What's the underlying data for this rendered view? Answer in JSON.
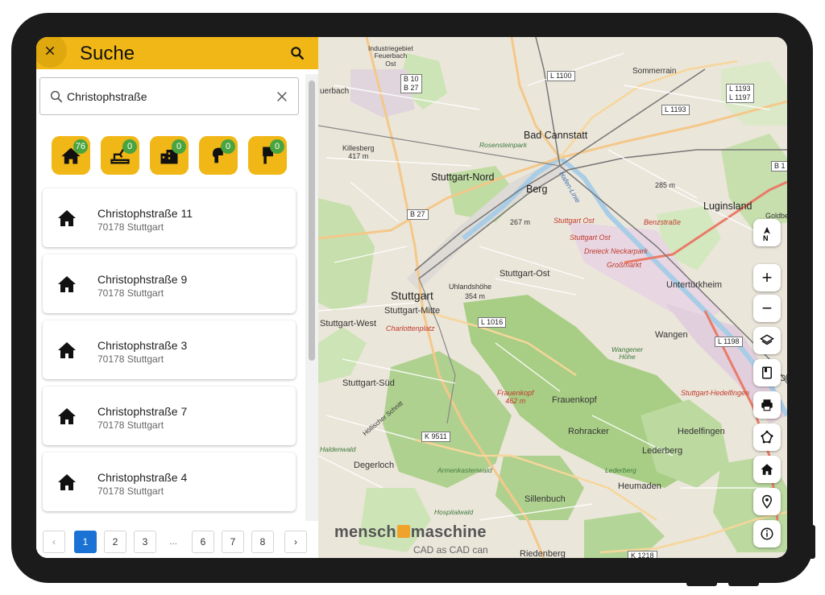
{
  "header": {
    "title": "Suche"
  },
  "search": {
    "value": "Christophstraße",
    "placeholder": ""
  },
  "categories": [
    {
      "icon": "house-icon",
      "count": "76"
    },
    {
      "icon": "excavator-icon",
      "count": "0"
    },
    {
      "icon": "building-icon",
      "count": "0"
    },
    {
      "icon": "hand-flag-icon",
      "count": "0"
    },
    {
      "icon": "flag-icon",
      "count": "0"
    }
  ],
  "results": [
    {
      "title": "Christophstraße 11",
      "subtitle": "70178 Stuttgart"
    },
    {
      "title": "Christophstraße 9",
      "subtitle": "70178 Stuttgart"
    },
    {
      "title": "Christophstraße 3",
      "subtitle": "70178 Stuttgart"
    },
    {
      "title": "Christophstraße 7",
      "subtitle": "70178 Stuttgart"
    },
    {
      "title": "Christophstraße 4",
      "subtitle": "70178 Stuttgart"
    }
  ],
  "pagination": {
    "prev": "‹",
    "next": "›",
    "ellipsis": "...",
    "pages": [
      "1",
      "2",
      "3",
      "6",
      "7",
      "8"
    ],
    "active_page": "1"
  },
  "map": {
    "labels": {
      "feuerbach": "uerbach",
      "industrie": "Industriegebiet\nFeuerbach\nOst",
      "sommerrain": "Sommerrain",
      "bad_cannstatt": "Bad Cannstatt",
      "rosenstein": "Rosensteinpark",
      "killesberg": "Killesberg\n417 m",
      "stuttgart_nord": "Stuttgart-Nord",
      "berg": "Berg",
      "hafen": "Hafen-Linie",
      "luginsland": "Luginsland",
      "goldberg": "Goldbe",
      "m285": "285 m",
      "m267": "267 m",
      "stuttgart_ost_red": "Stuttgart Ost",
      "stuttgart_ost_red2": "Stuttgart Ost",
      "benzstrasse": "Benzstraße",
      "dreieck": "Dreieck Neckarpark",
      "grossmarkt": "Großmarkt",
      "stuttgart": "Stuttgart",
      "stuttgart_mitte": "Stuttgart-Mitte",
      "stuttgart_ost": "Stuttgart-Ost",
      "uhlandshoehe": "Uhlandshöhe",
      "m354": "354 m",
      "untertuerkheim": "Untertürkheim",
      "stuttgart_west": "Stuttgart-West",
      "charlottenplatz": "Charlottenplatz",
      "wangen": "Wangen",
      "wangener_hoehe": "Wangener\nHöhe",
      "obe": "Obe",
      "stuttgart_sued": "Stuttgart-Süd",
      "frauenkopf_red": "Frauenkopf\n462 m",
      "frauenkopf": "Frauenkopf",
      "rohracker": "Rohracker",
      "hedelfingen_red": "Stuttgart-Hedelfingen",
      "hedelfingen": "Hedelfingen",
      "haldenwald": "Haldenwald",
      "degerloch": "Degerloch",
      "armenkastenwald": "Armenkastenwald",
      "lederberg": "Lederberg",
      "lederberg_g": "Lederberg",
      "heumaden": "Heumaden",
      "sillenbuch": "Sillenbuch",
      "hospitalwald": "Hospitalwald",
      "riedenberg": "Riedenberg",
      "hoellischer": "Höllischer Schnitt"
    },
    "roads": {
      "b10": "B 10\nB 27",
      "l1100": "L 1100",
      "l1193a": "L 1193\nL 1197",
      "l1193b": "L 1193",
      "b27": "B 27",
      "l1016": "L 1016",
      "l1198": "L 1198",
      "k9511": "K 9511",
      "k1218": "K 1218",
      "b1": "B 1"
    },
    "logo": {
      "part1": "mensch",
      "part2": "maschine",
      "tagline": "CAD as CAD can"
    }
  },
  "map_controls": {
    "north": "N",
    "zoom_in": "+",
    "zoom_out": "−"
  }
}
